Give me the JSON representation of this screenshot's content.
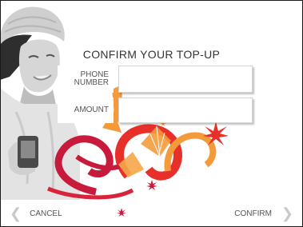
{
  "screen": {
    "title": "CONFIRM YOUR TOP-UP",
    "fields": {
      "phone_label_line1": "PHONE",
      "phone_label_line2": "NUMBER",
      "phone_value": "",
      "amount_label": "AMOUNT",
      "amount_value": ""
    },
    "nav": {
      "cancel_label": "CANCEL",
      "confirm_label": "CONFIRM"
    }
  },
  "icons": {
    "cancel_arrow": "chevron-left-icon",
    "confirm_arrow": "chevron-right-icon"
  },
  "colors": {
    "accent_red": "#e8302b",
    "accent_orange": "#f39b3a",
    "accent_magenta": "#c81a3b",
    "arrow_grey": "#c9c9c9",
    "text": "#555555"
  }
}
